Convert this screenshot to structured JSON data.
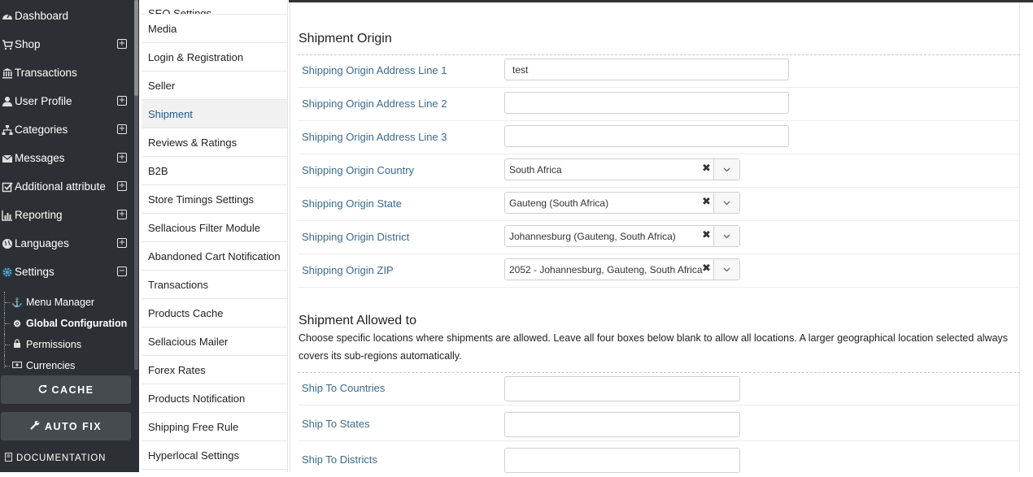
{
  "sidebar": {
    "items": [
      {
        "label": "Dashboard",
        "icon": "dashboard-icon",
        "expand": ""
      },
      {
        "label": "Shop",
        "icon": "cart-icon",
        "expand": "+"
      },
      {
        "label": "Transactions",
        "icon": "bank-icon",
        "expand": ""
      },
      {
        "label": "User Profile",
        "icon": "user-icon",
        "expand": "+"
      },
      {
        "label": "Categories",
        "icon": "sitemap-icon",
        "expand": "+"
      },
      {
        "label": "Messages",
        "icon": "envelope-icon",
        "expand": "+"
      },
      {
        "label": "Additional attribute",
        "icon": "checkbox-icon",
        "expand": "+"
      },
      {
        "label": "Reporting",
        "icon": "bar-chart-icon",
        "expand": "+"
      },
      {
        "label": "Languages",
        "icon": "globe-icon",
        "expand": "+"
      },
      {
        "label": "Settings",
        "icon": "gears-icon",
        "expand": "−"
      }
    ],
    "sub_items": [
      {
        "label": "Menu Manager",
        "icon": "anchor-icon"
      },
      {
        "label": "Global Configuration",
        "icon": "cogs-icon"
      },
      {
        "label": "Permissions",
        "icon": "lock-icon"
      },
      {
        "label": "Currencies",
        "icon": "money-icon"
      }
    ],
    "cache_label": "CACHE",
    "autofix_label": "AUTO FIX",
    "documentation_label": "DOCUMENTATION"
  },
  "tabs": [
    "SEO Settings",
    "Media",
    "Login & Registration",
    "Seller",
    "Shipment",
    "Reviews & Ratings",
    "B2B",
    "Store Timings Settings",
    "Sellacious Filter Module",
    "Abandoned Cart Notification",
    "Transactions",
    "Products Cache",
    "Sellacious Mailer",
    "Forex Rates",
    "Products Notification",
    "Shipping Free Rule",
    "Hyperlocal Settings"
  ],
  "active_tab": "Shipment",
  "origin": {
    "title": "Shipment Origin",
    "address1_label": "Shipping Origin Address Line 1",
    "address1_value": "test",
    "address2_label": "Shipping Origin Address Line 2",
    "address2_value": "",
    "address3_label": "Shipping Origin Address Line 3",
    "address3_value": "",
    "country_label": "Shipping Origin Country",
    "country_value": "South Africa",
    "state_label": "Shipping Origin State",
    "state_value": "Gauteng (South Africa)",
    "district_label": "Shipping Origin District",
    "district_value": "Johannesburg (Gauteng, South Africa)",
    "zip_label": "Shipping Origin ZIP",
    "zip_value": "2052 - Johannesburg, Gauteng, South Africa"
  },
  "allowed": {
    "title": "Shipment Allowed to",
    "description": "Choose specific locations where shipments are allowed. Leave all four boxes below blank to allow all locations. A larger geographical location selected always covers its sub-regions automatically.",
    "countries_label": "Ship To Countries",
    "states_label": "Ship To States",
    "districts_label": "Ship To Districts"
  }
}
